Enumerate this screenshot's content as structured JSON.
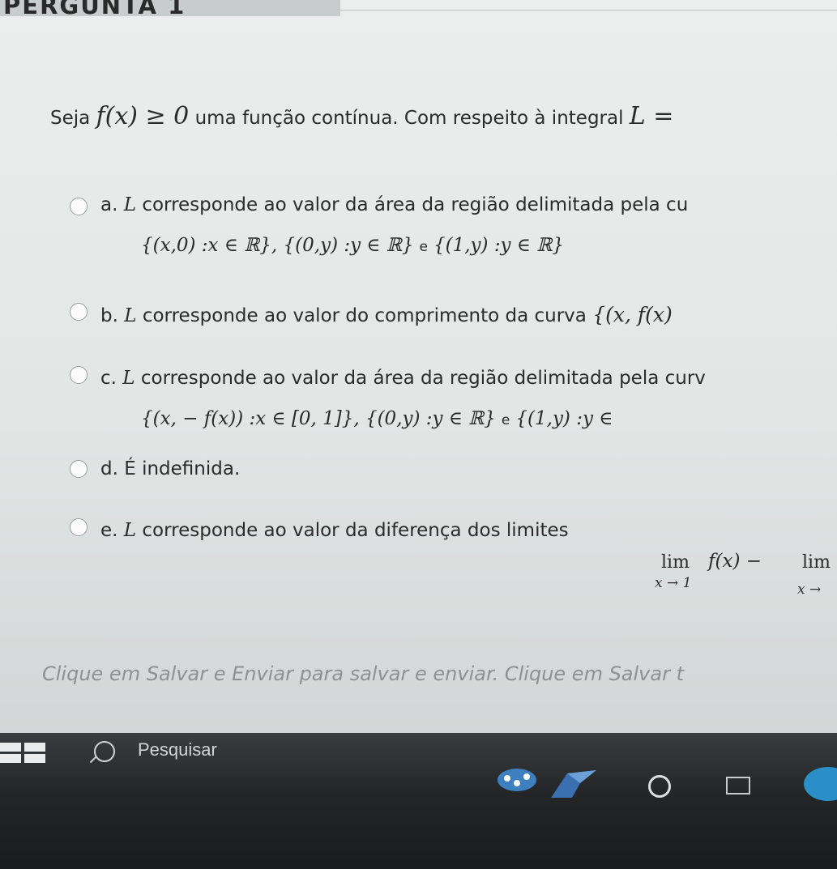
{
  "question": {
    "header": "PERGUNTA 1",
    "stem_prefix": "Seja",
    "stem_math": "f(x) ≥ 0",
    "stem_text": "uma função contínua. Com respeito à integral",
    "stem_math_end": "L ="
  },
  "options": [
    {
      "letter": "a.",
      "math_L": "L",
      "text": "corresponde ao valor da área da região delimitada pela cu",
      "sub_math_1": "{(x,0) :x ∈ ℝ}, {(0,y) :y ∈ ℝ}",
      "sub_e": "e",
      "sub_math_2": "{(1,y) :y ∈ ℝ}"
    },
    {
      "letter": "b.",
      "math_L": "L",
      "text": "corresponde ao valor do comprimento da curva",
      "math_end": "{(x, f(x)"
    },
    {
      "letter": "c.",
      "math_L": "L",
      "text": "corresponde ao valor da área da região delimitada pela curv",
      "sub_math_1": "{(x, − f(x)) :x ∈ [0, 1]}, {(0,y) :y ∈ ℝ}",
      "sub_e": "e",
      "sub_math_2": "{(1,y) :y ∈"
    },
    {
      "letter": "d.",
      "text": "É indefinida."
    },
    {
      "letter": "e.",
      "math_L": "L",
      "text": "corresponde ao valor da diferença dos limites",
      "lim_1": "lim",
      "lim_1_sub": "x → 1",
      "lim_expr": "f(x) −",
      "lim_2": "lim",
      "lim_2_sub": "x →"
    }
  ],
  "instruction": "Clique em Salvar e Enviar para salvar e enviar. Clique em Salvar t",
  "taskbar": {
    "search_placeholder": "Pesquisar"
  }
}
